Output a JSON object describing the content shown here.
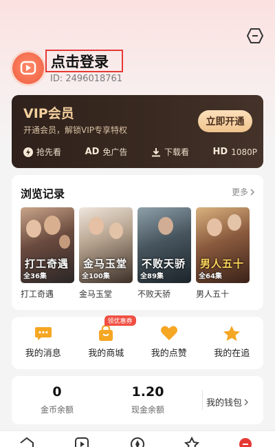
{
  "header": {
    "login_text": "点击登录",
    "user_id": "ID: 2496018761"
  },
  "vip": {
    "title": "VIP会员",
    "subtitle": "开通会员，解锁VIP专享特权",
    "button_label": "立即开通",
    "perks": [
      {
        "icon": "lightning-icon",
        "label": "抢先看",
        "prefix": ""
      },
      {
        "icon": "ad-icon",
        "label": "免广告",
        "prefix": "AD"
      },
      {
        "icon": "download-icon",
        "label": "下载看",
        "prefix": ""
      },
      {
        "icon": "hd-icon",
        "label": "1080P",
        "prefix": "HD"
      }
    ]
  },
  "history": {
    "title": "浏览记录",
    "more_label": "更多",
    "items": [
      {
        "name": "打工奇遇",
        "episodes": "全36集",
        "poster_text": "打工奇遇"
      },
      {
        "name": "金马玉堂",
        "episodes": "全100集",
        "poster_text": "金马玉堂"
      },
      {
        "name": "不败天骄",
        "episodes": "全89集",
        "poster_text": "不败天骄"
      },
      {
        "name": "男人五十",
        "episodes": "全64集",
        "poster_text": "男人五十"
      }
    ]
  },
  "shortcuts": {
    "coupon_badge": "领优惠券",
    "items": [
      {
        "icon": "message-icon",
        "label": "我的消息"
      },
      {
        "icon": "shop-bag-icon",
        "label": "我的商城"
      },
      {
        "icon": "heart-icon",
        "label": "我的点赞"
      },
      {
        "icon": "star-icon",
        "label": "我的在追"
      }
    ]
  },
  "wallet": {
    "coins_value": "0",
    "coins_label": "金币余额",
    "cash_value": "1.20",
    "cash_label": "现金余额",
    "link_label": "我的钱包"
  },
  "tabbar": {
    "icons": [
      "home-icon",
      "play-icon",
      "discover-icon",
      "star-tab-icon",
      "profile-icon"
    ]
  },
  "colors": {
    "accent": "#f5a623",
    "vip_gold": "#f4cf9e",
    "badge_red": "#f04f43"
  }
}
